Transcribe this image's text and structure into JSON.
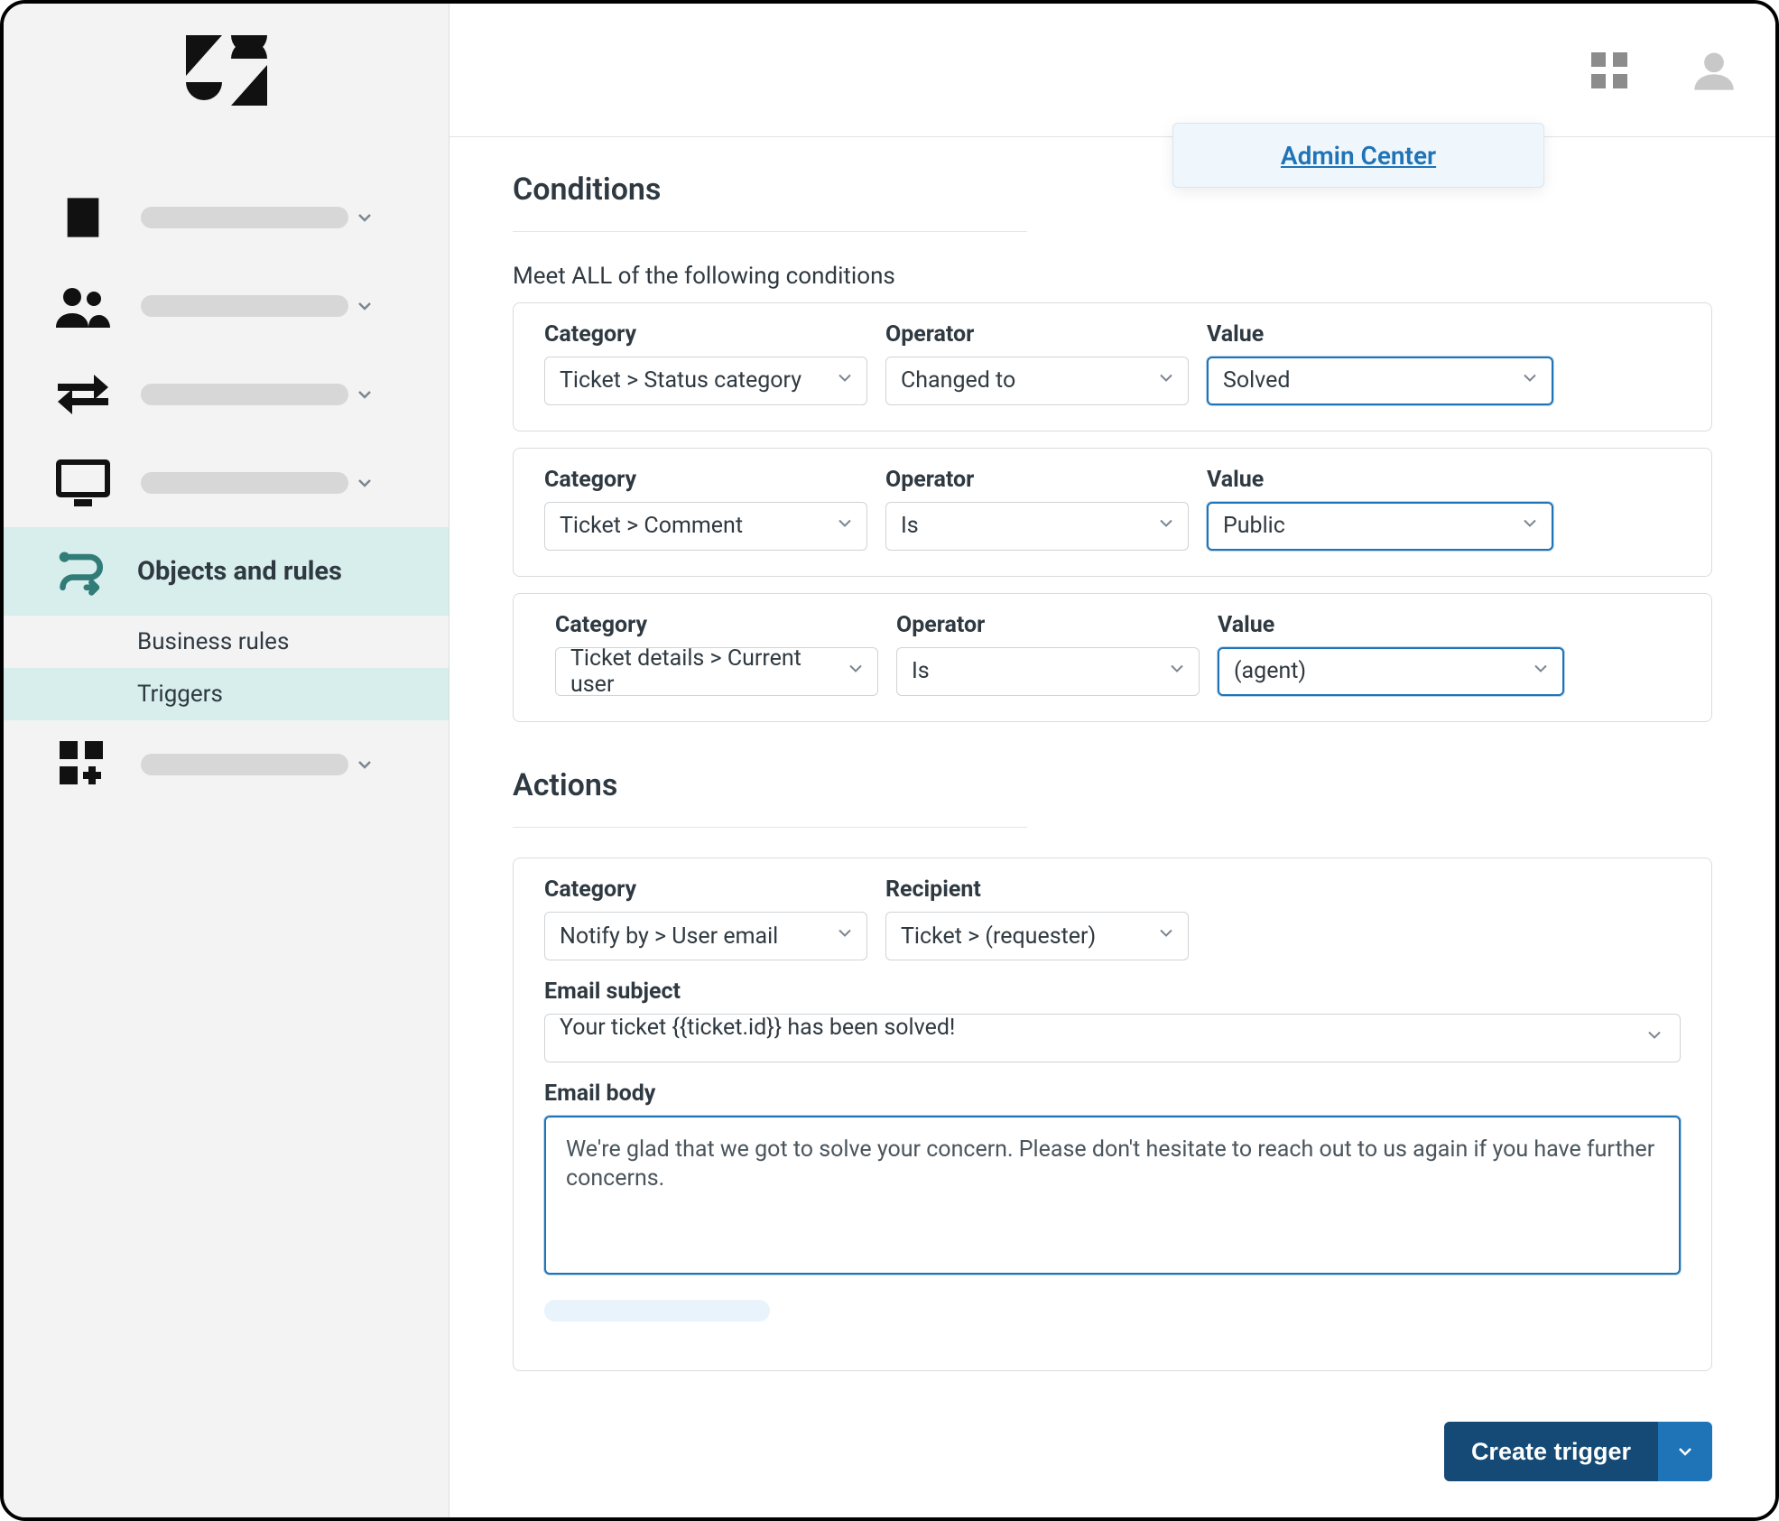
{
  "header": {
    "admin_center_label": "Admin Center"
  },
  "sidebar": {
    "items": [
      {
        "iconName": "building-icon"
      },
      {
        "iconName": "people-icon"
      },
      {
        "iconName": "transfer-icon"
      },
      {
        "iconName": "monitor-icon"
      }
    ],
    "active": {
      "iconName": "routing-icon",
      "label": "Objects and rules"
    },
    "sub": {
      "heading": "Business rules",
      "activeItem": "Triggers"
    },
    "lastItem": {
      "iconName": "apps-add-icon"
    }
  },
  "conditions": {
    "title": "Conditions",
    "sub_heading": "Meet ALL of the following conditions",
    "labels": {
      "category": "Category",
      "operator": "Operator",
      "value": "Value"
    },
    "rows": [
      {
        "category": "Ticket > Status category",
        "operator": "Changed to",
        "value": "Solved"
      },
      {
        "category": "Ticket > Comment",
        "operator": "Is",
        "value": "Public"
      },
      {
        "category": "Ticket details > Current user",
        "operator": "Is",
        "value": "(agent)"
      }
    ]
  },
  "actions": {
    "title": "Actions",
    "labels": {
      "category": "Category",
      "recipient": "Recipient",
      "email_subject": "Email subject",
      "email_body": "Email body"
    },
    "category_value": "Notify by > User email",
    "recipient_value": "Ticket > (requester)",
    "email_subject_value": "Your ticket {{ticket.id}} has been solved!",
    "email_body_value": "We're glad that we got to solve your concern. Please don't hesitate to reach out to us again if you have further concerns."
  },
  "footer": {
    "create_trigger_label": "Create trigger"
  }
}
